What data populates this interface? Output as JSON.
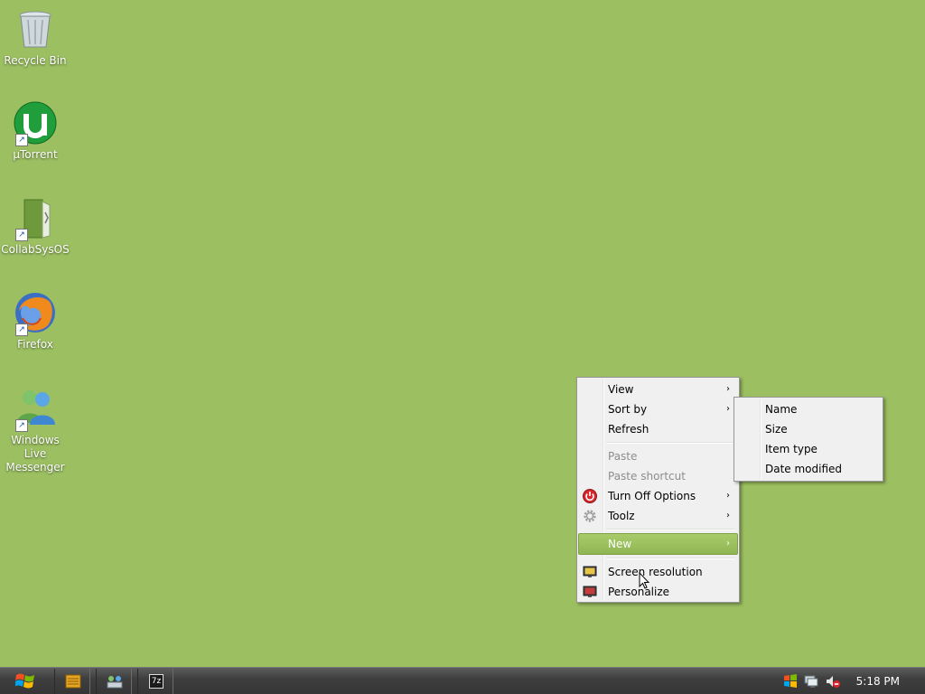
{
  "desktop": {
    "background": "#9bbf61",
    "icons": [
      {
        "label": "Recycle Bin",
        "icon": "recycle-bin-icon"
      },
      {
        "label": "µTorrent",
        "icon": "utorrent-icon"
      },
      {
        "label": "CollabSysOS",
        "icon": "collabsysos-icon"
      },
      {
        "label": "Firefox",
        "icon": "firefox-icon"
      },
      {
        "label": "Windows Live Messenger",
        "icon": "windows-live-messenger-icon"
      }
    ]
  },
  "context_menu": {
    "items": [
      {
        "label": "View",
        "arrow": "›"
      },
      {
        "label": "Sort by",
        "arrow": "›"
      },
      {
        "label": "Refresh"
      },
      {
        "label": "Paste"
      },
      {
        "label": "Paste shortcut"
      },
      {
        "label": "Turn Off Options",
        "arrow": "›",
        "icon": "power-icon"
      },
      {
        "label": "Toolz",
        "arrow": "›",
        "icon": "gear-icon"
      },
      {
        "label": "New",
        "arrow": "›"
      },
      {
        "label": "Screen resolution",
        "icon": "screen-resolution-icon"
      },
      {
        "label": "Personalize",
        "icon": "personalize-icon"
      }
    ],
    "highlight_color": "#9cc45f"
  },
  "sort_submenu": {
    "items": [
      {
        "label": "Name"
      },
      {
        "label": "Size"
      },
      {
        "label": "Item type"
      },
      {
        "label": "Date modified"
      }
    ]
  },
  "taskbar": {
    "start_icon": "windows-start-icon",
    "pinned": [
      "folder-icon",
      "network-icon",
      "7zip-icon"
    ],
    "pinned_text": {
      "sevenzip": "7z"
    },
    "tray_icons": [
      "windows-flag-icon",
      "network-status-icon",
      "volume-muted-icon"
    ],
    "clock": "5:18 PM"
  }
}
